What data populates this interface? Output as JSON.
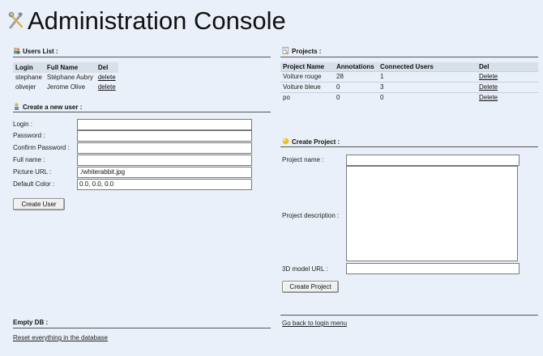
{
  "page": {
    "title": "Administration Console"
  },
  "users": {
    "heading": "Users List :",
    "columns": [
      "Login",
      "Full Name",
      "Del"
    ],
    "rows": [
      {
        "login": "stephane",
        "full_name": "Stéphane Aubry",
        "del": "delete"
      },
      {
        "login": "olivejer",
        "full_name": "Jerome Olive",
        "del": "delete"
      }
    ]
  },
  "create_user": {
    "heading": "Create a new user :",
    "fields": {
      "login": {
        "label": "Login :",
        "value": ""
      },
      "password": {
        "label": "Password :",
        "value": ""
      },
      "confirm_password": {
        "label": "Confirm Password :",
        "value": ""
      },
      "full_name": {
        "label": "Full name :",
        "value": ""
      },
      "picture_url": {
        "label": "Picture URL :",
        "value": "./whiterabbit.jpg"
      },
      "default_color": {
        "label": "Default Color :",
        "value": "0.0, 0.0, 0.0"
      }
    },
    "button": "Create User"
  },
  "projects": {
    "heading": "Projects :",
    "columns": [
      "Project Name",
      "Annotations",
      "Connected Users",
      "Del"
    ],
    "rows": [
      {
        "name": "Voiture rouge",
        "annotations": "28",
        "connected": "1",
        "del": "Delete"
      },
      {
        "name": "Voiture bleue",
        "annotations": "0",
        "connected": "3",
        "del": "Delete"
      },
      {
        "name": "po",
        "annotations": "0",
        "connected": "0",
        "del": "Delete"
      }
    ]
  },
  "create_project": {
    "heading": "Create Project :",
    "fields": {
      "project_name": {
        "label": "Project name :",
        "value": ""
      },
      "project_description": {
        "label": "Project description :",
        "value": ""
      },
      "model_url": {
        "label": "3D model URL :",
        "value": ""
      }
    },
    "button": "Create Project"
  },
  "empty_db": {
    "heading": "Empty DB :",
    "link": "Reset everything in the database"
  },
  "back_link": "Go back to login menu",
  "icons": {
    "title": "tools-icon",
    "users": "users-icon",
    "new_user": "new-user-icon",
    "projects": "projects-icon",
    "create_project": "create-project-icon"
  }
}
